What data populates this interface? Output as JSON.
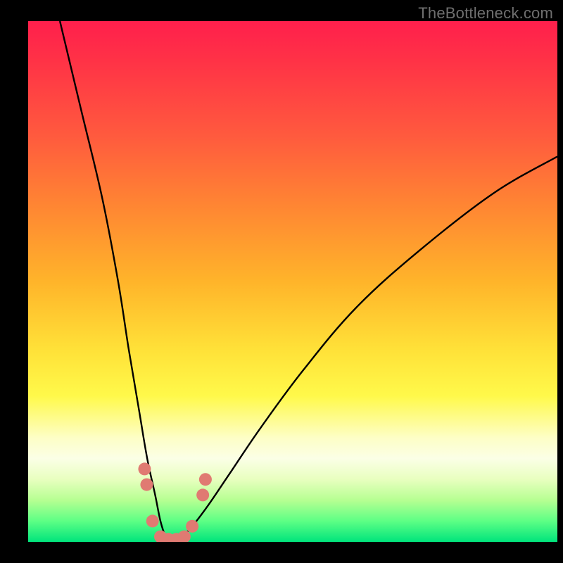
{
  "watermark": "TheBottleneck.com",
  "chart_data": {
    "type": "line",
    "title": "",
    "xlabel": "",
    "ylabel": "",
    "xlim": [
      0,
      100
    ],
    "ylim": [
      0,
      100
    ],
    "curves": {
      "description": "Two black curves descending into a V-shaped dip near x≈27, then rising; plotted over a vertical red→green gradient background.",
      "left": {
        "x": [
          6,
          10,
          14,
          17,
          19,
          21,
          22.5,
          24,
          25,
          26,
          27
        ],
        "y": [
          100,
          83,
          66,
          50,
          37,
          25,
          16,
          9,
          4,
          1,
          0
        ]
      },
      "right": {
        "x": [
          27,
          29,
          31,
          34,
          38,
          44,
          52,
          62,
          74,
          88,
          100
        ],
        "y": [
          0,
          1,
          3,
          7,
          13,
          22,
          33,
          45,
          56,
          67,
          74
        ]
      }
    },
    "markers": {
      "description": "Salmon-colored dots clustered around the trough of the V.",
      "points": [
        {
          "x": 22.0,
          "y": 14
        },
        {
          "x": 22.4,
          "y": 11
        },
        {
          "x": 23.5,
          "y": 4
        },
        {
          "x": 25.0,
          "y": 1
        },
        {
          "x": 26.5,
          "y": 0.5
        },
        {
          "x": 28.0,
          "y": 0.5
        },
        {
          "x": 29.5,
          "y": 1
        },
        {
          "x": 31.0,
          "y": 3
        },
        {
          "x": 33.0,
          "y": 9
        },
        {
          "x": 33.5,
          "y": 12
        }
      ],
      "color": "#e07a72"
    }
  }
}
